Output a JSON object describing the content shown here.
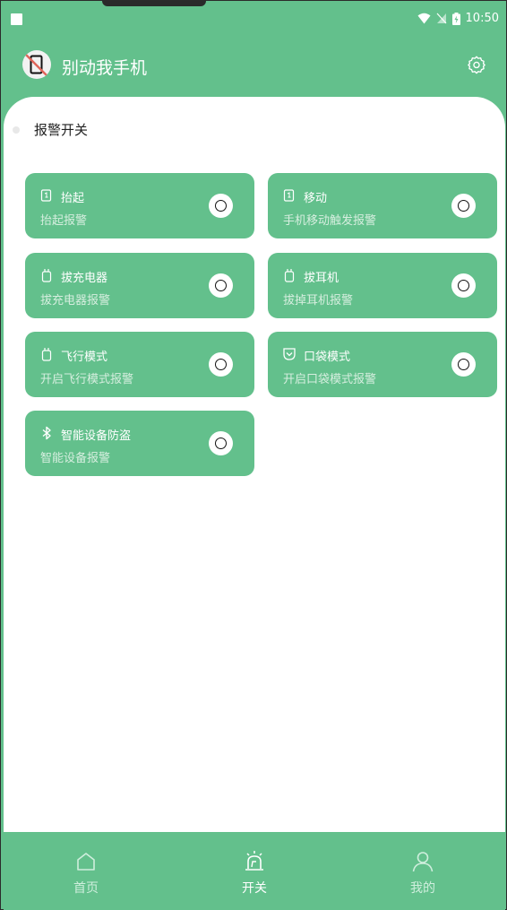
{
  "status_bar": {
    "time": "10:50"
  },
  "app": {
    "title": "别动我手机"
  },
  "section": {
    "title": "报警开关"
  },
  "cards": [
    {
      "title": "抬起",
      "subtitle": "抬起报警",
      "icon": "phone-lift-icon"
    },
    {
      "title": "移动",
      "subtitle": "手机移动触发报警",
      "icon": "phone-move-icon"
    },
    {
      "title": "拔充电器",
      "subtitle": "拔充电器报警",
      "icon": "charger-plug-icon"
    },
    {
      "title": "拔耳机",
      "subtitle": "拔掉耳机报警",
      "icon": "earphone-plug-icon"
    },
    {
      "title": "飞行模式",
      "subtitle": "开启飞行模式报警",
      "icon": "airplane-mode-icon"
    },
    {
      "title": "口袋模式",
      "subtitle": "开启口袋模式报警",
      "icon": "pocket-icon"
    },
    {
      "title": "智能设备防盗",
      "subtitle": "智能设备报警",
      "icon": "bluetooth-icon"
    }
  ],
  "bottom_nav": [
    {
      "label": "首页",
      "icon": "home-icon",
      "active": false
    },
    {
      "label": "开关",
      "icon": "alarm-icon",
      "active": true
    },
    {
      "label": "我的",
      "icon": "profile-icon",
      "active": false
    }
  ],
  "colors": {
    "primary": "#63c08c",
    "panel": "#ffffff"
  }
}
